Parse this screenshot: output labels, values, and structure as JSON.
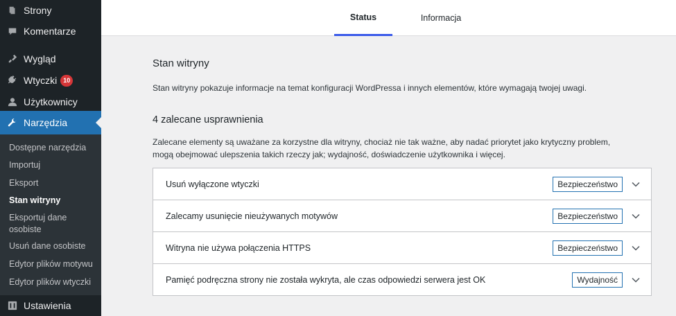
{
  "sidebar": {
    "top_items": [
      {
        "label": "Strony",
        "icon": "pages-icon"
      },
      {
        "label": "Komentarze",
        "icon": "comments-icon"
      },
      {
        "label": "Wygląd",
        "icon": "appearance-icon"
      },
      {
        "label": "Wtyczki",
        "icon": "plugins-icon",
        "badge": "10"
      },
      {
        "label": "Użytkownicy",
        "icon": "users-icon"
      },
      {
        "label": "Narzędzia",
        "icon": "tools-icon",
        "active": true
      }
    ],
    "submenu": [
      "Dostępne narzędzia",
      "Importuj",
      "Eksport",
      "Stan witryny",
      "Eksportuj dane osobiste",
      "Usuń dane osobiste",
      "Edytor plików motywu",
      "Edytor plików wtyczki"
    ],
    "current_submenu": "Stan witryny",
    "bottom_item": {
      "label": "Ustawienia",
      "icon": "settings-icon"
    }
  },
  "tabs": [
    {
      "label": "Status",
      "active": true
    },
    {
      "label": "Informacja",
      "active": false
    }
  ],
  "main": {
    "title": "Stan witryny",
    "description": "Stan witryny pokazuje informacje na temat konfiguracji WordPressa i innych elementów, które wymagają twojej uwagi.",
    "recommended_heading": "4 zalecane usprawnienia",
    "recommended_description": "Zalecane elementy są uważane za korzystne dla witryny, chociaż nie tak ważne, aby nadać priorytet jako krytyczny problem, mogą obejmować ulepszenia takich rzeczy jak; wydajność, doświadczenie użytkownika i więcej.",
    "issues": [
      {
        "title": "Usuń wyłączone wtyczki",
        "badge": "Bezpieczeństwo"
      },
      {
        "title": "Zalecamy usunięcie nieużywanych motywów",
        "badge": "Bezpieczeństwo"
      },
      {
        "title": "Witryna nie używa połączenia HTTPS",
        "badge": "Bezpieczeństwo"
      },
      {
        "title": "Pamięć podręczna strony nie została wykryta, ale czas odpowiedzi serwera jest OK",
        "badge": "Wydajność"
      }
    ]
  },
  "colors": {
    "sidebar_bg": "#1d2327",
    "submenu_bg": "#2c3338",
    "active_bg": "#2271b1",
    "badge_bg": "#d63638",
    "tab_accent": "#3858e9"
  }
}
